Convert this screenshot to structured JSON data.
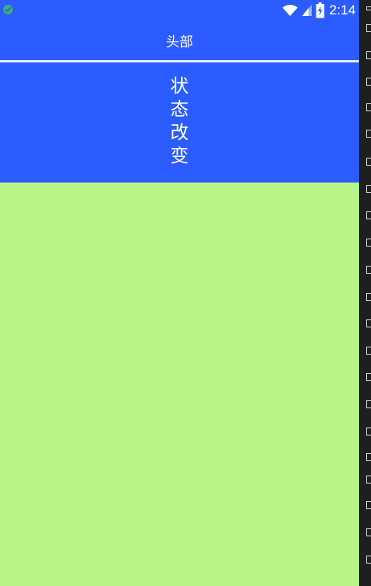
{
  "status_bar": {
    "time": "2:14",
    "icons": [
      "notification-dot-icon",
      "wifi-icon",
      "signal-icon",
      "battery-charging-icon"
    ]
  },
  "header": {
    "title": "头部"
  },
  "state_panel": {
    "chars": [
      "状",
      "态",
      "改",
      "变"
    ]
  },
  "colors": {
    "primary_blue": "#2b5cff",
    "content_green": "#b9f586",
    "divider": "#e6ecff",
    "side_strip": "#1f1f1f"
  }
}
